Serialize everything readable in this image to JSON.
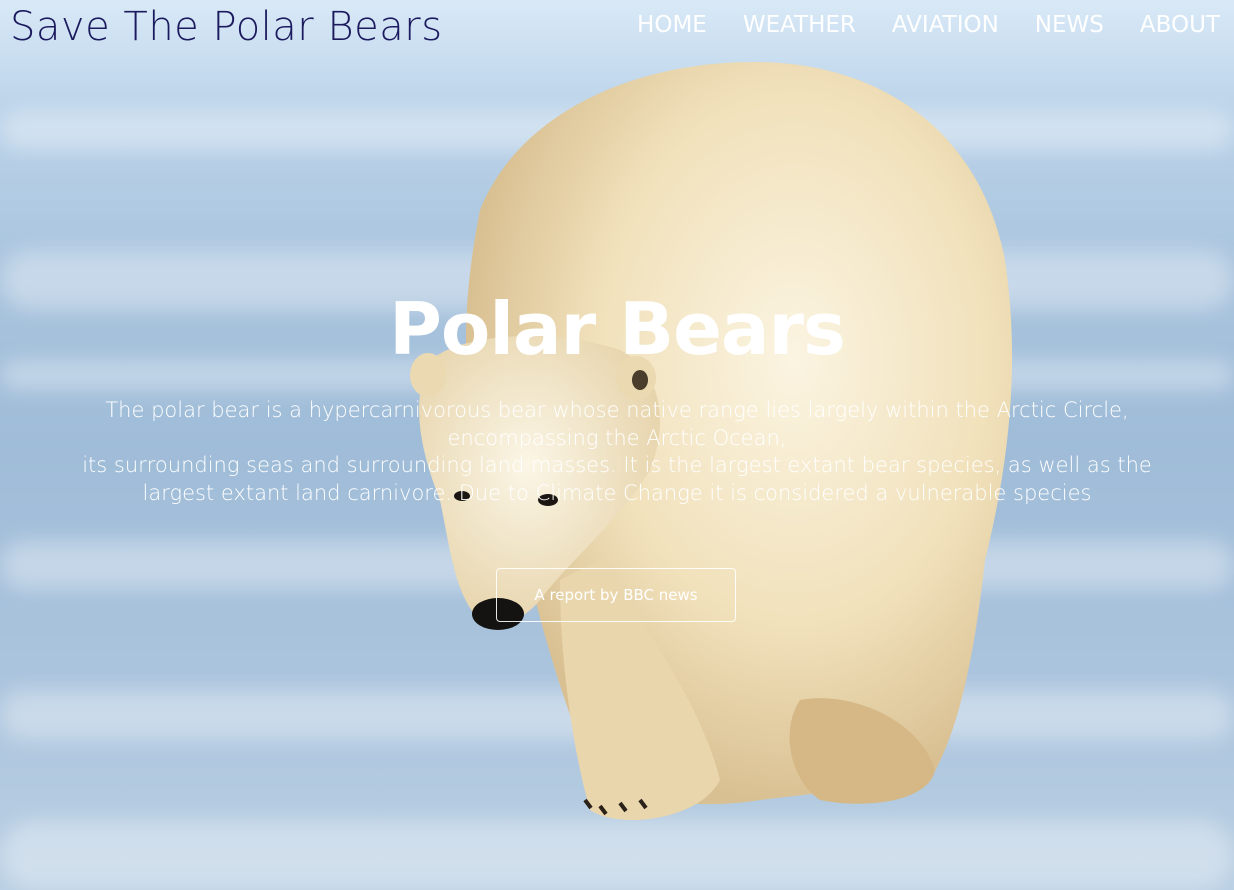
{
  "header": {
    "logo": "Save The Polar Bears",
    "nav": [
      "HOME",
      "WEATHER",
      "AVIATION",
      "NEWS",
      "ABOUT"
    ]
  },
  "hero": {
    "title": "Polar Bears",
    "lines": [
      "The polar bear is a hypercarnivorous bear whose native range lies largely within the Arctic Circle,",
      "encompassing the Arctic Ocean,",
      "its surrounding seas and surrounding land masses. It is the largest extant bear species, as well as the",
      "largest extant land carnivore. Due to Climate Change it is considered a vulnerable species"
    ],
    "button_label": "A report by BBC news"
  },
  "background": {
    "image": "polar-bear-walking-on-ice",
    "sky_color": "#d9e9f7",
    "ice_color": "#a9c4de",
    "fur_color": "#f3e6c6"
  }
}
